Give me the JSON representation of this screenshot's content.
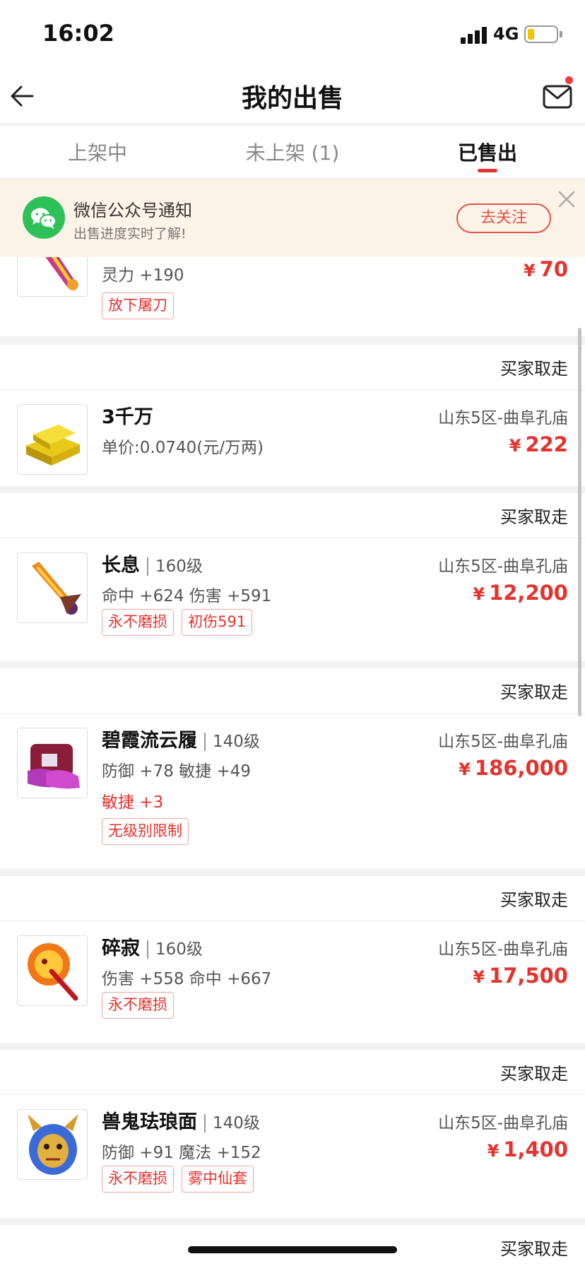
{
  "status_bar": {
    "time": "16:02",
    "network": "4G"
  },
  "header": {
    "title": "我的出售"
  },
  "tabs": [
    {
      "label": "上架中"
    },
    {
      "label": "未上架 (1)"
    },
    {
      "label": "已售出"
    }
  ],
  "active_tab": "已售出",
  "notice": {
    "title": "微信公众号通知",
    "subtitle": "出售进度实时了解!",
    "button_label": "去关注"
  },
  "items": [
    {
      "status": "",
      "name": "",
      "level": "",
      "attrs": "灵力 +190",
      "special": "",
      "tags": [
        "放下屠刀"
      ],
      "server": "",
      "price": "70"
    },
    {
      "status": "买家取走",
      "name": "3千万",
      "level": "",
      "attrs": "单价:0.0740(元/万两)",
      "special": "",
      "tags": [],
      "server": "山东5区-曲阜孔庙",
      "price": "222"
    },
    {
      "status": "买家取走",
      "name": "长息",
      "level": "160级",
      "attrs": "命中 +624 伤害 +591",
      "special": "",
      "tags": [
        "永不磨损",
        "初伤591"
      ],
      "server": "山东5区-曲阜孔庙",
      "price": "12,200"
    },
    {
      "status": "买家取走",
      "name": "碧霞流云履",
      "level": "140级",
      "attrs": "防御 +78 敏捷 +49",
      "special": "敏捷 +3",
      "tags": [
        "无级别限制"
      ],
      "server": "山东5区-曲阜孔庙",
      "price": "186,000"
    },
    {
      "status": "买家取走",
      "name": "碎寂",
      "level": "160级",
      "attrs": "伤害 +558 命中 +667",
      "special": "",
      "tags": [
        "永不磨损"
      ],
      "server": "山东5区-曲阜孔庙",
      "price": "17,500"
    },
    {
      "status": "买家取走",
      "name": "兽鬼珐琅面",
      "level": "140级",
      "attrs": "防御 +91 魔法 +152",
      "special": "",
      "tags": [
        "永不磨损",
        "雾中仙套"
      ],
      "server": "山东5区-曲阜孔庙",
      "price": "1,400"
    },
    {
      "status": "买家取走"
    }
  ],
  "currency_symbol": "¥",
  "colors": {
    "accent": "#e5322d",
    "notice_bg": "#fdf3e6",
    "wechat": "#2ec158"
  }
}
